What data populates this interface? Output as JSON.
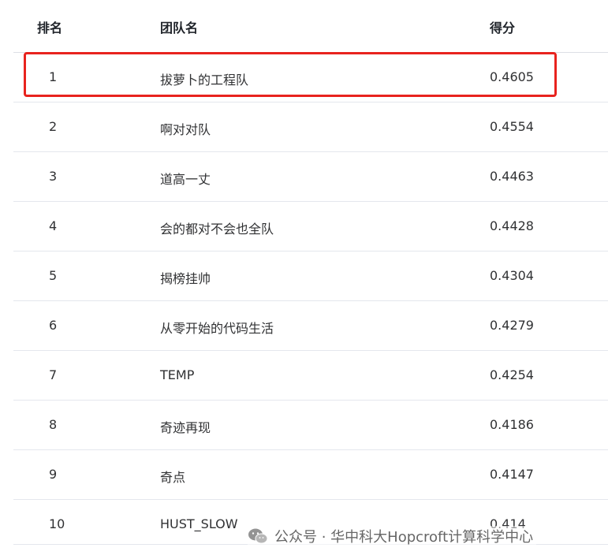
{
  "table": {
    "headers": {
      "rank": "排名",
      "team": "团队名",
      "score": "得分"
    },
    "rows": [
      {
        "rank": "1",
        "team": "拔萝卜的工程队",
        "score": "0.4605"
      },
      {
        "rank": "2",
        "team": "啊对对队",
        "score": "0.4554"
      },
      {
        "rank": "3",
        "team": "道高一丈",
        "score": "0.4463"
      },
      {
        "rank": "4",
        "team": "会的都对不会也全队",
        "score": "0.4428"
      },
      {
        "rank": "5",
        "team": "揭榜挂帅",
        "score": "0.4304"
      },
      {
        "rank": "6",
        "team": "从零开始的代码生活",
        "score": "0.4279"
      },
      {
        "rank": "7",
        "team": "TEMP",
        "score": "0.4254"
      },
      {
        "rank": "8",
        "team": "奇迹再现",
        "score": "0.4186"
      },
      {
        "rank": "9",
        "team": "奇点",
        "score": "0.4147"
      },
      {
        "rank": "10",
        "team": "HUST_SLOW",
        "score": "0.414"
      }
    ]
  },
  "highlight": {
    "color": "#e8231e",
    "row_rank": "1"
  },
  "watermark": {
    "icon": "wechat-icon",
    "text": "公众号 · 华中科大Hopcroft计算科学中心"
  }
}
